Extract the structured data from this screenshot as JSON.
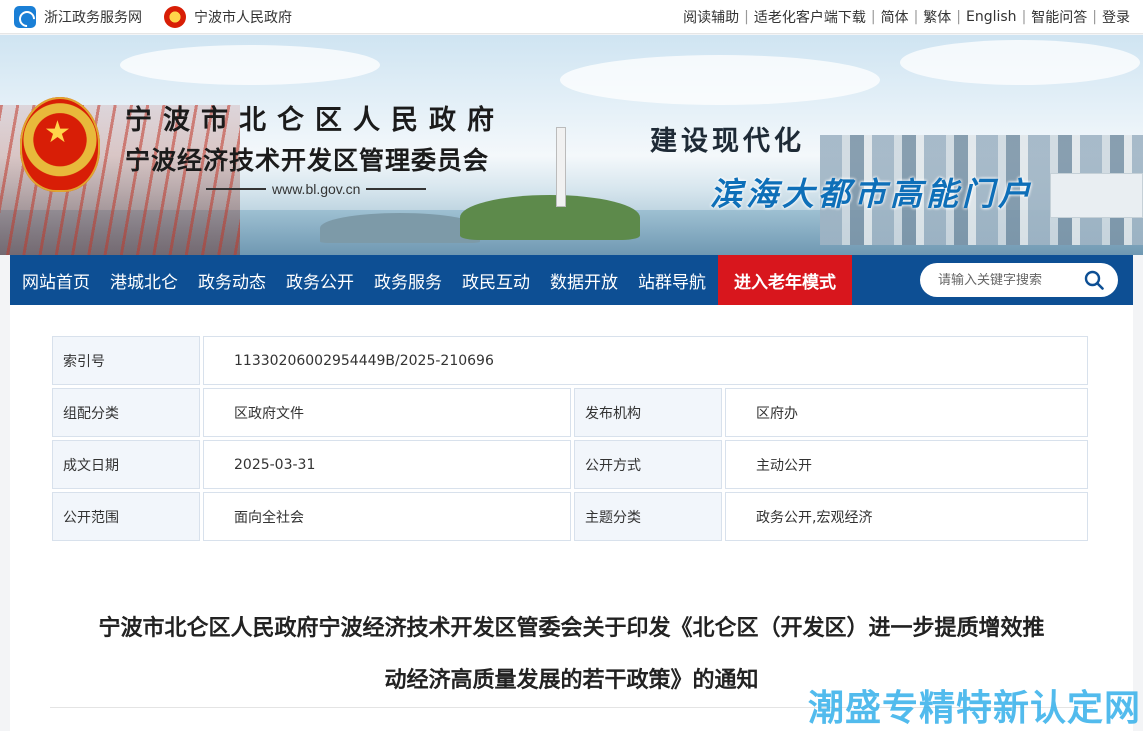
{
  "topbar": {
    "site1": "浙江政务服务网",
    "site2": "宁波市人民政府",
    "links": [
      "阅读辅助",
      "适老化客户端下载",
      "简体",
      "繁体",
      "English",
      "智能问答",
      "登录"
    ]
  },
  "banner": {
    "org_line1": "宁波市北仑区人民政府",
    "org_line2": "宁波经济技术开发区管理委员会",
    "url": "www.bl.gov.cn",
    "slogan1": "建设现代化",
    "slogan2": "滨海大都市高能门户"
  },
  "nav": {
    "items": [
      "网站首页",
      "港城北仑",
      "政务动态",
      "政务公开",
      "政务服务",
      "政民互动",
      "数据开放",
      "站群导航"
    ],
    "elder_mode": "进入老年模式",
    "search_placeholder": "请输入关键字搜索"
  },
  "meta": {
    "index_label": "索引号",
    "index_value": "11330206002954449B/2025-210696",
    "category_label": "组配分类",
    "category_value": "区政府文件",
    "publisher_label": "发布机构",
    "publisher_value": "区府办",
    "date_label": "成文日期",
    "date_value": "2025-03-31",
    "disclose_label": "公开方式",
    "disclose_value": "主动公开",
    "scope_label": "公开范围",
    "scope_value": "面向全社会",
    "topic_label": "主题分类",
    "topic_value": "政务公开,宏观经济"
  },
  "document": {
    "title_line1": "宁波市北仑区人民政府宁波经济技术开发区管委会关于印发《北仑区（开发区）进一步提质增效推",
    "title_line2": "动经济高质量发展的若干政策》的通知"
  },
  "watermark": "潮盛专精特新认定网",
  "colors": {
    "nav_bg": "#0d4f94",
    "elder_btn": "#d8161d",
    "watermark": "#34b0ea"
  }
}
